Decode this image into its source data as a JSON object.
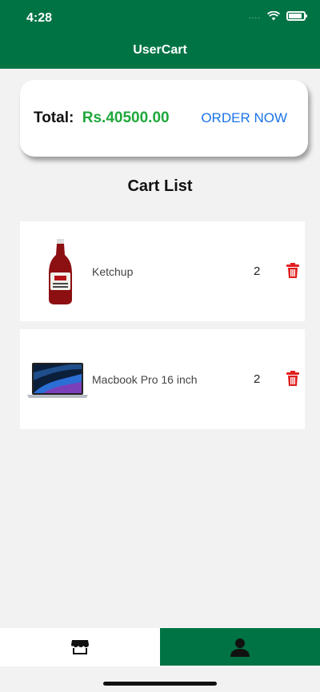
{
  "status_bar": {
    "time": "4:28",
    "dots": "....",
    "icons": [
      "wifi-icon",
      "battery-icon"
    ]
  },
  "header": {
    "title": "UserCart",
    "color": "#007345"
  },
  "total": {
    "label": "Total:",
    "value": "Rs.40500.00",
    "value_color": "#1fa83c",
    "order_label": "ORDER NOW",
    "order_color": "#1a73e8"
  },
  "cart": {
    "title": "Cart List",
    "items": [
      {
        "name": "Ketchup",
        "quantity": "2",
        "image": "ketchup-bottle-image",
        "action_icon": "trash-icon"
      },
      {
        "name": "Macbook Pro 16 inch",
        "quantity": "2",
        "image": "laptop-image",
        "action_icon": "trash-icon"
      }
    ],
    "delete_color": "#e11d1d"
  },
  "tab_bar": {
    "tabs": [
      {
        "icon": "store-icon",
        "active": true
      },
      {
        "icon": "user-icon",
        "active": false
      }
    ]
  }
}
